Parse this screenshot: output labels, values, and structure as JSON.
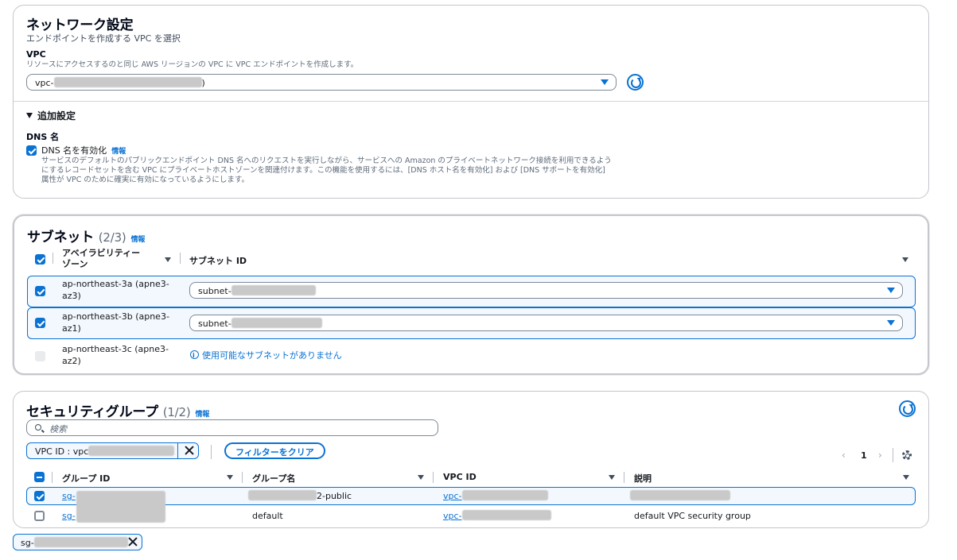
{
  "network": {
    "title": "ネットワーク設定",
    "subtitle": "エンドポイントを作成する VPC を選択",
    "vpc_label": "VPC",
    "vpc_desc": "リソースにアクセスするのと同じ AWS リージョンの VPC に VPC エンドポイントを作成します。",
    "vpc_value_prefix": "vpc-",
    "vpc_value_suffix": ")",
    "additional_title": "追加設定",
    "dns_label": "DNS 名",
    "dns_checkbox": "DNS 名を有効化",
    "dns_info": "情報",
    "dns_desc_1": "サービスのデフォルトのパブリックエンドポイント DNS 名へのリクエストを実行しながら、サービスへの Amazon のプライベートネットワーク接続を利用できるよう",
    "dns_desc_2": "にするレコードセットを含む VPC にプライベートホストゾーンを関連付けます。この機能を使用するには、[DNS ホスト名を有効化] および [DNS サポートを有効化]",
    "dns_desc_3": "属性が VPC のために確実に有効になっているようにします。"
  },
  "subnets": {
    "title": "サブネット",
    "count": "(2/3)",
    "info": "情報",
    "col_az_1": "アベイラビリティー",
    "col_az_2": "ゾーン",
    "col_subnet": "サブネット ID",
    "rows": [
      {
        "az_1": "ap-northeast-3a (apne3-",
        "az_2": "az3)",
        "subnet_prefix": "subnet-",
        "checked": true
      },
      {
        "az_1": "ap-northeast-3b (apne3-",
        "az_2": "az1)",
        "subnet_prefix": "subnet-",
        "checked": true
      },
      {
        "az_1": "ap-northeast-3c (apne3-",
        "az_2": "az2)",
        "no_subnet": "使用可能なサブネットがありません",
        "checked": false
      }
    ]
  },
  "security": {
    "title": "セキュリティグループ",
    "count": "(1/2)",
    "info": "情報",
    "search_placeholder": "検索",
    "filter_token": "VPC ID : vpc",
    "clear_filter": "フィルターをクリア",
    "page": "1",
    "col_group_id": "グループ ID",
    "col_group_name": "グループ名",
    "col_vpc_id": "VPC ID",
    "col_desc": "説明",
    "rows": [
      {
        "group_id": "sg-",
        "group_name_suffix": "2-public",
        "vpc_id": "vpc-",
        "desc": "",
        "checked": true
      },
      {
        "group_id": "sg-",
        "group_name": "default",
        "vpc_id": "vpc-",
        "desc": "default VPC security group",
        "checked": false
      }
    ],
    "selected_token": "sg-"
  },
  "colors": {
    "accent": "#0972d3",
    "border": "#c6c6cd",
    "text": "#16191f"
  }
}
